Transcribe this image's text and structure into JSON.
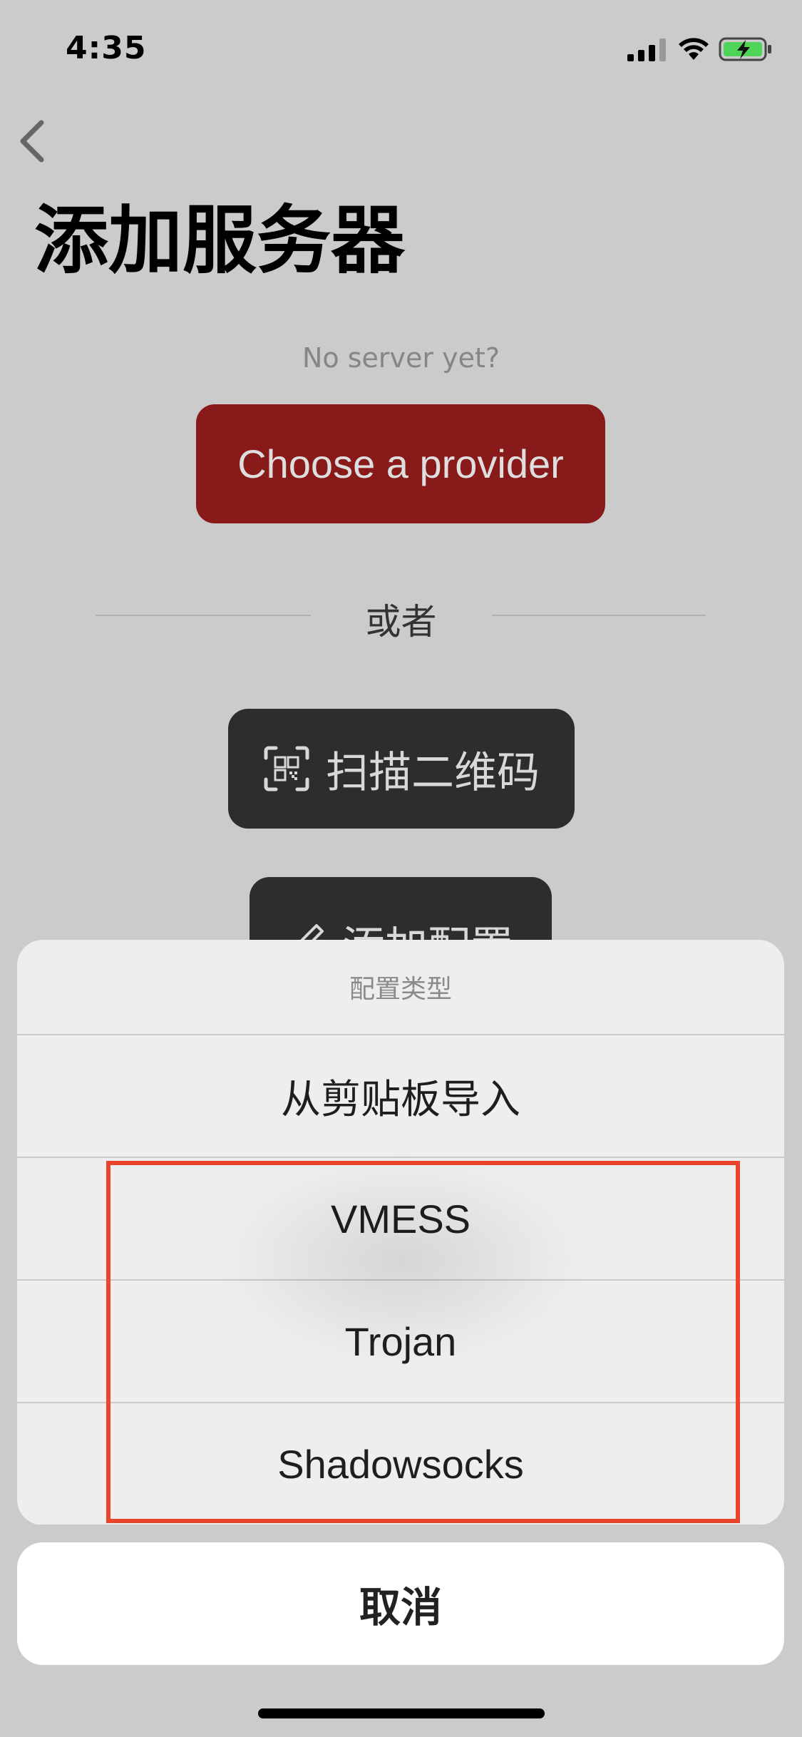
{
  "status_bar": {
    "time": "4:35"
  },
  "page": {
    "title": "添加服务器",
    "no_server_text": "No server yet?",
    "provider_button": "Choose a provider",
    "divider_text": "或者",
    "scan_button": "扫描二维码",
    "add_config_button": "添加配置"
  },
  "action_sheet": {
    "title": "配置类型",
    "items": [
      "从剪贴板导入",
      "VMESS",
      "Trojan",
      "Shadowsocks"
    ],
    "cancel": "取消"
  },
  "colors": {
    "provider_button": "#891a1a",
    "dark_button": "#2d2d2d",
    "highlight": "#e8442e",
    "battery": "#4fd45a"
  },
  "icons": [
    "back-chevron-icon",
    "qr-scan-icon",
    "pencil-icon",
    "cellular-signal-icon",
    "wifi-icon",
    "battery-charging-icon"
  ]
}
